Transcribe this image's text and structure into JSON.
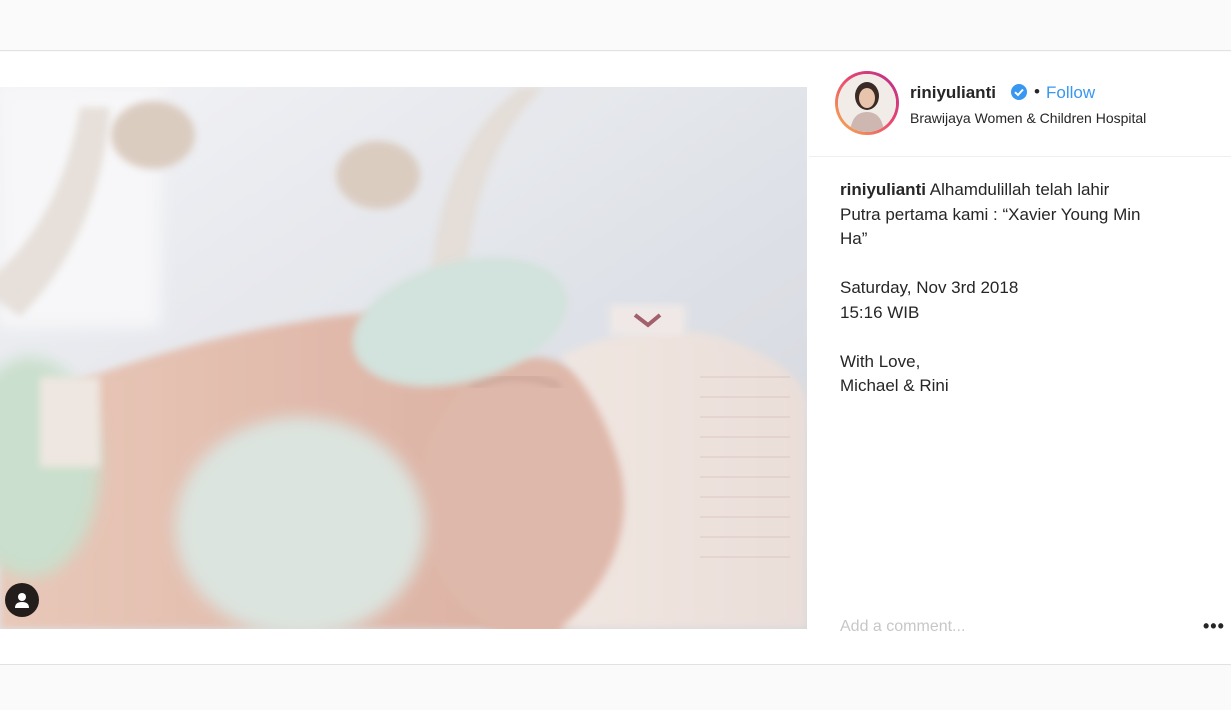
{
  "post": {
    "username": "riniyulianti",
    "verified_icon": "verified-badge-icon",
    "separator": "•",
    "follow_label": "Follow",
    "location": "Brawijaya Women & Children Hospital",
    "caption": {
      "username": "riniyulianti",
      "lines": [
        "Alhamdulillah telah lahir",
        "Putra pertama kami : “Xavier Young Min",
        "Ha”",
        "",
        "Saturday, Nov 3rd 2018",
        "15:16 WIB",
        "",
        "With Love,",
        "Michael & Rini"
      ]
    },
    "comment_placeholder": "Add a comment...",
    "more_label": "•••",
    "photo_alt": "Newborn baby with white knit hat and mittens sleeping in incubator",
    "tag_icon": "user-tag-icon"
  },
  "colors": {
    "accent": "#3897f0",
    "text": "#262626",
    "placeholder": "#c7c7c7",
    "avatar_ring": "#e8456f"
  }
}
